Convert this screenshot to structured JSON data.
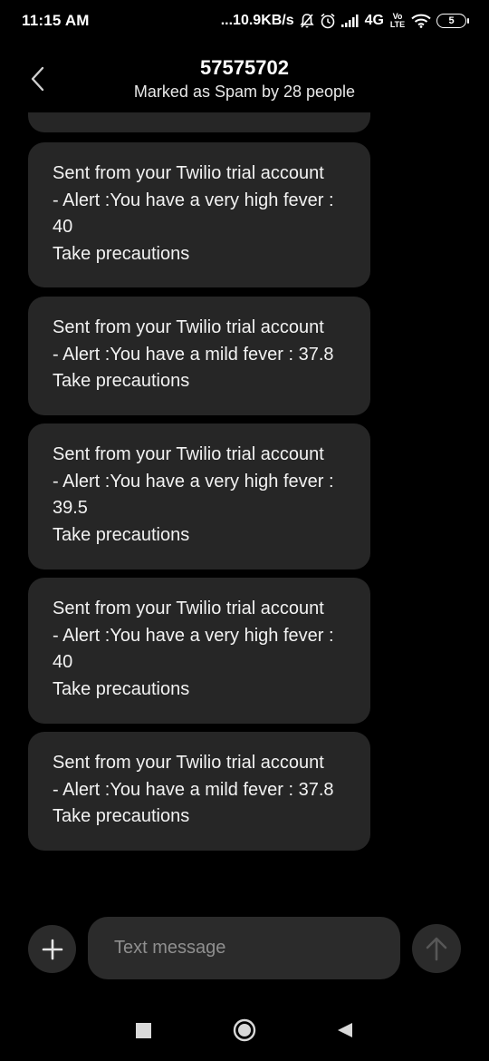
{
  "status_bar": {
    "time": "11:15 AM",
    "net_speed": "...10.9KB/s",
    "network_type": "4G",
    "volte_label": "Vo LTE",
    "battery": "5",
    "icons": [
      "mute-icon",
      "alarm-icon",
      "signal-icon",
      "volte-icon",
      "wifi-icon",
      "battery-icon"
    ]
  },
  "header": {
    "title": "57575702",
    "subtitle": "Marked as Spam by 28 people",
    "back_icon": "chevron-left-icon"
  },
  "messages": [
    {
      "text": "Sent from your Twilio trial account\n- Alert :You have a very high fever :\n40\nTake precautions"
    },
    {
      "text": "Sent from your Twilio trial account\n- Alert :You have a mild fever : 37.8\nTake precautions"
    },
    {
      "text": "Sent from your Twilio trial account\n- Alert :You have a very high fever :\n39.5\nTake precautions"
    },
    {
      "text": "Sent from your Twilio trial account\n- Alert :You have a very high fever :\n40\nTake precautions"
    },
    {
      "text": "Sent from your Twilio trial account\n- Alert :You have a mild fever : 37.8\nTake precautions"
    }
  ],
  "composer": {
    "placeholder": "Text message",
    "add_icon": "plus-icon",
    "send_icon": "arrow-up-icon"
  },
  "nav_bar": {
    "icons": [
      "recents-square-icon",
      "home-circle-icon",
      "back-triangle-icon"
    ]
  },
  "colors": {
    "background": "#000000",
    "bubble": "#262626",
    "button": "#2b2b2b",
    "text": "#ffffff",
    "placeholder": "#8f8f8f",
    "send_arrow": "#555555"
  }
}
